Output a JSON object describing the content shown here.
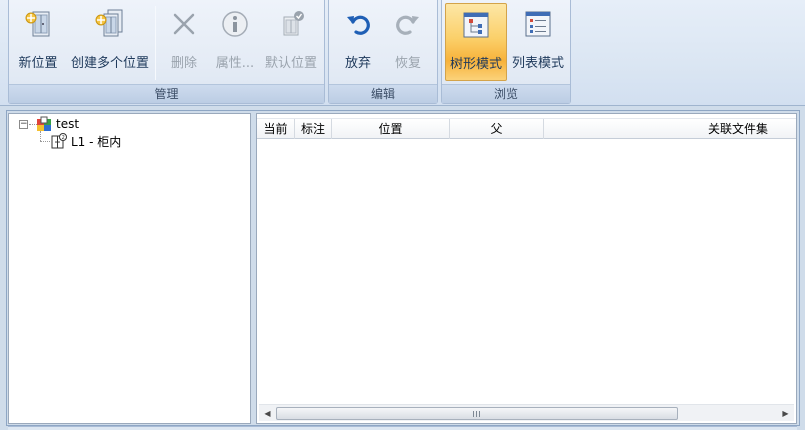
{
  "ribbon": {
    "groups": [
      {
        "label": "管理",
        "buttons": [
          {
            "label": "新位置",
            "icon": "new-location-icon",
            "enabled": true
          },
          {
            "label": "创建多个位置",
            "icon": "create-multiple-locations-icon",
            "enabled": true
          },
          {
            "label": "删除",
            "icon": "delete-x-icon",
            "enabled": false
          },
          {
            "label": "属性...",
            "icon": "info-icon",
            "enabled": false
          },
          {
            "label": "默认位置",
            "icon": "default-location-icon",
            "enabled": false
          }
        ]
      },
      {
        "label": "编辑",
        "buttons": [
          {
            "label": "放弃",
            "icon": "undo-icon",
            "enabled": true
          },
          {
            "label": "恢复",
            "icon": "redo-icon",
            "enabled": false
          }
        ]
      },
      {
        "label": "浏览",
        "buttons": [
          {
            "label": "树形模式",
            "icon": "tree-mode-icon",
            "enabled": true,
            "active": true
          },
          {
            "label": "列表模式",
            "icon": "list-mode-icon",
            "enabled": true
          }
        ]
      }
    ]
  },
  "tree": {
    "root": {
      "label": "test",
      "expander": "⊟"
    },
    "child": {
      "label": "L1 - 柜内"
    }
  },
  "table": {
    "columns": [
      "当前",
      "标注",
      "位置",
      "父",
      "关联文件集"
    ]
  },
  "colors": {
    "accent_active": "#f7b23b",
    "ribbon_bg": "#dbe6f3",
    "frame_bg": "#cfdcea"
  }
}
